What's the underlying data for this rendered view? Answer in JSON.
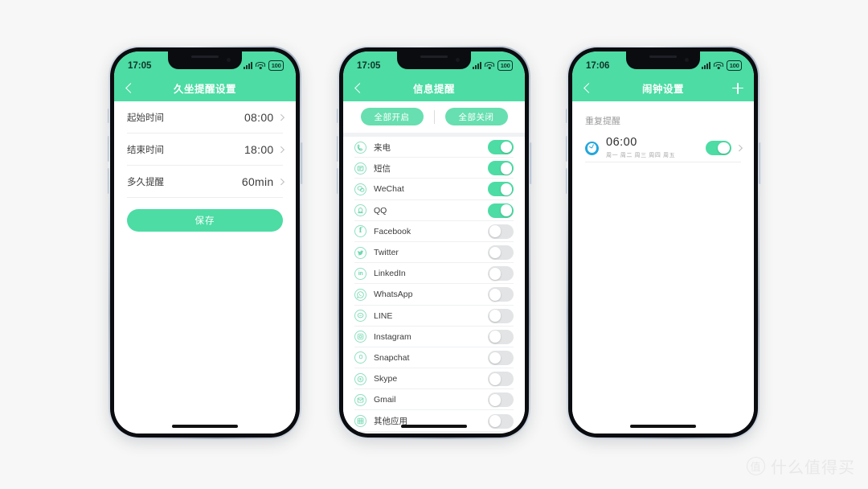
{
  "background_color": "#f7f7f7",
  "accent_green": "#4CDCA4",
  "watermark": {
    "logo_char": "值",
    "text": "什么值得买"
  },
  "phones": [
    {
      "id": "phone-sedentary-reminder",
      "status_bar": {
        "time": "17:05",
        "battery": "100",
        "signal_icon": "signal-bars-icon",
        "wifi_icon": "wifi-icon",
        "battery_icon": "battery-icon"
      },
      "nav": {
        "back_icon": "back-chevron-icon",
        "title": "久坐提醒设置"
      },
      "rows": [
        {
          "label": "起始时间",
          "value": "08:00",
          "chevron": "chevron-right-icon"
        },
        {
          "label": "结束时间",
          "value": "18:00",
          "chevron": "chevron-right-icon"
        },
        {
          "label": "多久提醒",
          "value": "60min",
          "chevron": "chevron-right-icon"
        }
      ],
      "save_label": "保存"
    },
    {
      "id": "phone-message-reminder",
      "status_bar": {
        "time": "17:05",
        "battery": "100"
      },
      "nav": {
        "back_icon": "back-chevron-icon",
        "title": "信息提醒"
      },
      "buttons": {
        "all_on": "全部开启",
        "all_off": "全部关闭"
      },
      "apps": [
        {
          "name": "来电",
          "icon": "phone-call-icon",
          "on": true
        },
        {
          "name": "短信",
          "icon": "sms-icon",
          "on": true
        },
        {
          "name": "WeChat",
          "icon": "wechat-icon",
          "on": true
        },
        {
          "name": "QQ",
          "icon": "qq-icon",
          "on": true
        },
        {
          "name": "Facebook",
          "icon": "facebook-icon",
          "on": false
        },
        {
          "name": "Twitter",
          "icon": "twitter-icon",
          "on": false
        },
        {
          "name": "LinkedIn",
          "icon": "linkedin-icon",
          "on": false
        },
        {
          "name": "WhatsApp",
          "icon": "whatsapp-icon",
          "on": false
        },
        {
          "name": "LINE",
          "icon": "line-icon",
          "on": false
        },
        {
          "name": "Instagram",
          "icon": "instagram-icon",
          "on": false
        },
        {
          "name": "Snapchat",
          "icon": "snapchat-icon",
          "on": false
        },
        {
          "name": "Skype",
          "icon": "skype-icon",
          "on": false
        },
        {
          "name": "Gmail",
          "icon": "gmail-icon",
          "on": false
        },
        {
          "name": "其他应用",
          "icon": "other-apps-icon",
          "on": false
        }
      ]
    },
    {
      "id": "phone-alarm-settings",
      "status_bar": {
        "time": "17:06",
        "battery": "100"
      },
      "nav": {
        "back_icon": "back-chevron-icon",
        "title": "闹钟设置",
        "add_icon": "plus-icon"
      },
      "section_title": "重复提醒",
      "alarm": {
        "icon": "alarm-clock-icon",
        "time": "06:00",
        "days": "周一 周二 周三 周四 周五",
        "on": true,
        "chevron": "chevron-right-icon"
      }
    }
  ]
}
